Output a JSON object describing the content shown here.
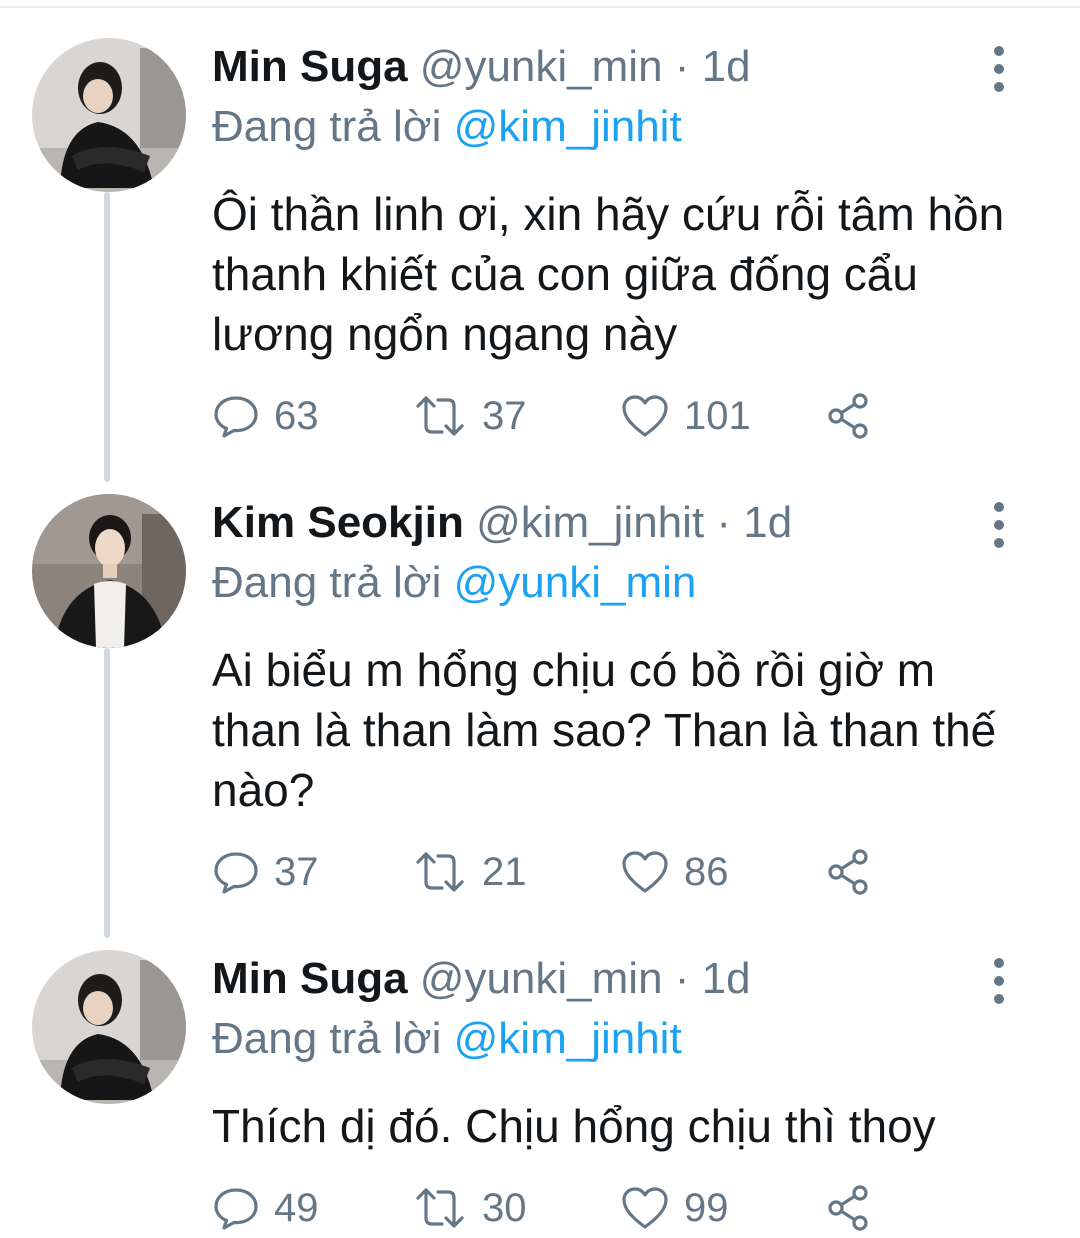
{
  "tweets": [
    {
      "name": "Min Suga",
      "handle": "@yunki_min",
      "separator": "·",
      "time": "1d",
      "reply_prefix": "Đang trả lời",
      "reply_to": "@kim_jinhit",
      "text": "Ôi thần linh ơi, xin hãy cứu rỗi tâm hồn thanh khiết của con giữa đống cẩu lương ngổn ngang này",
      "replies": "63",
      "retweets": "37",
      "likes": "101"
    },
    {
      "name": "Kim Seokjin",
      "handle": "@kim_jinhit",
      "separator": "·",
      "time": "1d",
      "reply_prefix": "Đang trả lời",
      "reply_to": "@yunki_min",
      "text": "Ai biểu m hổng chịu có bồ rồi giờ m than là than làm sao? Than là than thế nào?",
      "replies": "37",
      "retweets": "21",
      "likes": "86"
    },
    {
      "name": "Min Suga",
      "handle": "@yunki_min",
      "separator": "·",
      "time": "1d",
      "reply_prefix": "Đang trả lời",
      "reply_to": "@kim_jinhit",
      "text": "Thích dị đó. Chịu hổng chịu thì thoy",
      "replies": "49",
      "retweets": "30",
      "likes": "99"
    }
  ],
  "icons": {
    "reply": "reply-icon",
    "retweet": "retweet-icon",
    "like": "heart-icon",
    "share": "share-icon",
    "more": "more-vertical-icon"
  },
  "colors": {
    "text": "#14171a",
    "secondary": "#657786",
    "link": "#1da1f2",
    "thread_line": "#cfd9de"
  }
}
